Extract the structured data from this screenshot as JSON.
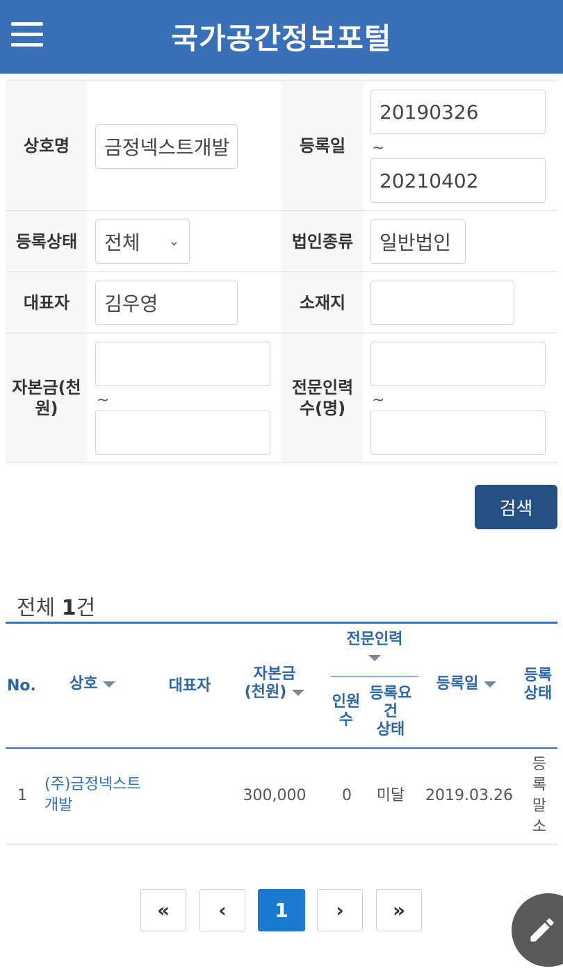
{
  "header": {
    "title": "국가공간정보포털",
    "menu_icon": "hamburger-menu-icon"
  },
  "form": {
    "company_name": {
      "label": "상호명",
      "value": "금정넥스트개발"
    },
    "reg_date": {
      "label": "등록일",
      "from": "20190326",
      "tilde": "~",
      "to": "20210402"
    },
    "reg_status": {
      "label": "등록상태",
      "value": "전체"
    },
    "corp_type": {
      "label": "법인종류",
      "value": "일반법인"
    },
    "representative": {
      "label": "대표자",
      "value": "김우영"
    },
    "location": {
      "label": "소재지",
      "value": ""
    },
    "capital": {
      "label_l1": "자본금(천",
      "label_l2": "원)",
      "tilde": "~"
    },
    "staff": {
      "label_l1": "전문인력",
      "label_l2": "수(명)",
      "tilde": "~"
    },
    "search_button": "검색"
  },
  "results": {
    "total_prefix": "전체 ",
    "total_count": "1",
    "total_suffix": "건",
    "headers": {
      "no": "No.",
      "company": "상호",
      "rep": "대표자",
      "capital_l1": "자본금",
      "capital_l2": "(천원)",
      "staff": "전문인력",
      "staff_count_l1": "인원",
      "staff_count_l2": "수",
      "req_l1": "등록요",
      "req_l2": "건",
      "req_l3": "상태",
      "reg_date": "등록일",
      "status_l1": "등록",
      "status_l2": "상태"
    },
    "rows": [
      {
        "no": "1",
        "company_l1": "(주)금정넥스트",
        "company_l2": "개발",
        "rep": "",
        "capital": "300,000",
        "staff_count": "0",
        "req_status": "미달",
        "reg_date": "2019.03.26",
        "status_chars": [
          "등",
          "록",
          "말",
          "소"
        ]
      }
    ]
  },
  "pagination": {
    "first": "«",
    "prev": "‹",
    "current": "1",
    "next": "›",
    "last": "»"
  },
  "fab_icon": "pencil-icon",
  "colors": {
    "header": "#3a70b8",
    "search_button": "#254f85",
    "header_text": "#2a66a8",
    "link": "#2a73c0",
    "page_active": "#1c7bd0"
  }
}
